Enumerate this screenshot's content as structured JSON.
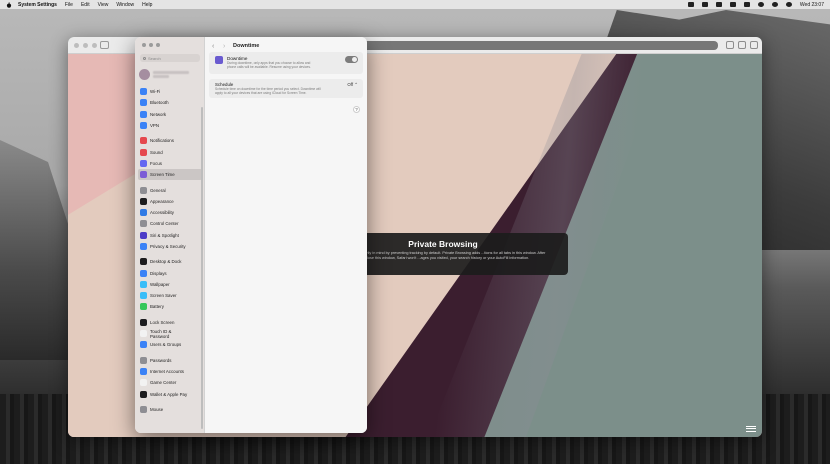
{
  "menubar": {
    "app_name": "System Settings",
    "menus": [
      "File",
      "Edit",
      "View",
      "Window",
      "Help"
    ],
    "clock": "Wed 23:07"
  },
  "settings": {
    "search_placeholder": "Search",
    "page_title": "Downtime",
    "groups": [
      [
        {
          "label": "Wi-Fi",
          "color": "#3b82f6"
        },
        {
          "label": "Bluetooth",
          "color": "#3b82f6"
        },
        {
          "label": "Network",
          "color": "#3b82f6"
        },
        {
          "label": "VPN",
          "color": "#3b82f6"
        }
      ],
      [
        {
          "label": "Notifications",
          "color": "#e5484d"
        },
        {
          "label": "Sound",
          "color": "#e5484d"
        },
        {
          "label": "Focus",
          "color": "#6366f1"
        },
        {
          "label": "Screen Time",
          "color": "#7c5cd6"
        }
      ],
      [
        {
          "label": "General",
          "color": "#8e8e93"
        },
        {
          "label": "Appearance",
          "color": "#1c1c1e"
        },
        {
          "label": "Accessibility",
          "color": "#2f7ae5"
        },
        {
          "label": "Control Center",
          "color": "#8e8e93"
        },
        {
          "label": "Siri & Spotlight",
          "color": "#4b3bc7"
        },
        {
          "label": "Privacy & Security",
          "color": "#3b82f6"
        }
      ],
      [
        {
          "label": "Desktop & Dock",
          "color": "#1c1c1e"
        },
        {
          "label": "Displays",
          "color": "#3b82f6"
        },
        {
          "label": "Wallpaper",
          "color": "#38bdf8"
        },
        {
          "label": "Screen Saver",
          "color": "#38bdf8"
        },
        {
          "label": "Battery",
          "color": "#34c759"
        }
      ],
      [
        {
          "label": "Lock Screen",
          "color": "#1c1c1e"
        },
        {
          "label": "Touch ID &\nPassword",
          "color": "#f2f2f2"
        },
        {
          "label": "Users & Groups",
          "color": "#3b82f6"
        }
      ],
      [
        {
          "label": "Passwords",
          "color": "#8e8e93"
        },
        {
          "label": "Internet Accounts",
          "color": "#3b82f6"
        },
        {
          "label": "Game Center",
          "color": "#f2f2f2"
        },
        {
          "label": "Wallet & Apple Pay",
          "color": "#1c1c1e"
        }
      ],
      [
        {
          "label": "Mouse",
          "color": "#8e8e93"
        }
      ]
    ],
    "selected_item": "Screen Time",
    "downtime": {
      "title": "Downtime",
      "description": "During downtime, only apps that you choose to allow and phone calls will be available. Resume using your devices.",
      "enabled": true
    },
    "schedule": {
      "title": "Schedule",
      "description": "Schedule time on downtime for the time period you select. Downtime will apply to all your devices that are using iCloud for Screen Time.",
      "value": "Off ⌃"
    },
    "help_label": "?"
  },
  "safari": {
    "private_title": "Private Browsing",
    "private_body": "...marily in mind by preventing tracking by default. Private Browsing adds ...tions for all tabs in this window. After you close this window, Safari won't ...ages you visited, your search history or your AutoFill information."
  }
}
